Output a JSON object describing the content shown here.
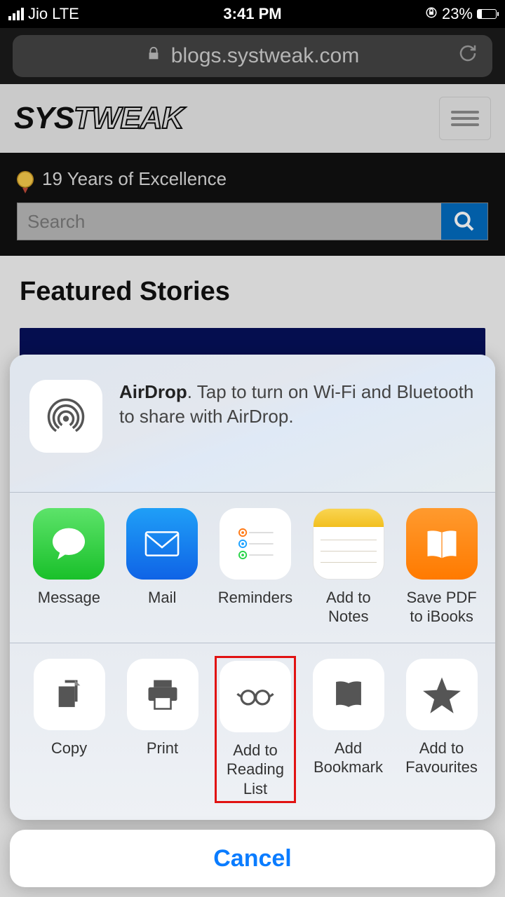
{
  "statusbar": {
    "carrier": "Jio",
    "network": "LTE",
    "time": "3:41 PM",
    "battery": "23%"
  },
  "addressbar": {
    "url": "blogs.systweak.com"
  },
  "page": {
    "logo_pre": "SYS",
    "logo_rest": "TWEAK",
    "tagline": "19 Years of Excellence",
    "search_placeholder": "Search",
    "featured_title": "Featured Stories"
  },
  "share": {
    "airdrop_title": "AirDrop",
    "airdrop_text": ". Tap to turn on Wi-Fi and Bluetooth to share with AirDrop.",
    "apps": [
      {
        "label": "Message"
      },
      {
        "label": "Mail"
      },
      {
        "label": "Reminders"
      },
      {
        "label": "Add to Notes"
      },
      {
        "label": "Save PDF to iBooks"
      }
    ],
    "actions": [
      {
        "label": "Copy"
      },
      {
        "label": "Print"
      },
      {
        "label": "Add to Reading List"
      },
      {
        "label": "Add Bookmark"
      },
      {
        "label": "Add to Favourites"
      }
    ],
    "cancel": "Cancel"
  }
}
